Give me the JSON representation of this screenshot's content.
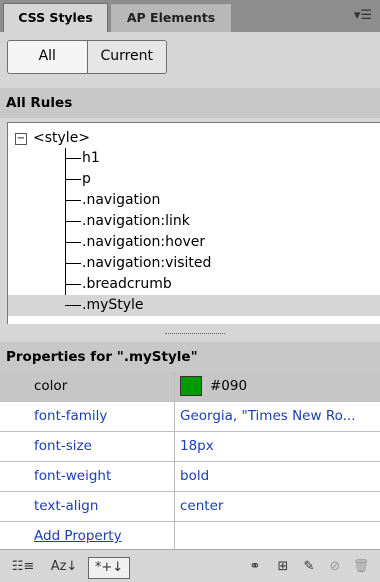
{
  "tabs": [
    {
      "label": "CSS Styles",
      "active": true
    },
    {
      "label": "AP Elements",
      "active": false
    }
  ],
  "mode": {
    "all": "All",
    "current": "Current",
    "selected": "All"
  },
  "all_rules": {
    "heading": "All Rules",
    "root": "<style>",
    "root_expander": "−",
    "items": [
      "h1",
      "p",
      ".navigation",
      ".navigation:link",
      ".navigation:hover",
      ".navigation:visited",
      ".breadcrumb",
      ".myStyle"
    ],
    "selected": ".myStyle"
  },
  "properties": {
    "heading": "Properties for \".myStyle\"",
    "rows": [
      {
        "name": "color",
        "value": "#090",
        "swatch": "#009900"
      },
      {
        "name": "font-family",
        "value": "Georgia, \"Times New Ro..."
      },
      {
        "name": "font-size",
        "value": "18px"
      },
      {
        "name": "font-weight",
        "value": "bold"
      },
      {
        "name": "text-align",
        "value": "center"
      }
    ],
    "add_label": "Add Property"
  },
  "toolbar": {
    "category_view": "☷≡",
    "alpha_view": "Az↓",
    "set_props_view": "*+↓",
    "icons": [
      "attach-style-sheet-icon",
      "new-css-rule-icon",
      "edit-rule-icon",
      "disable-property-icon",
      "delete-icon"
    ]
  },
  "colors": {
    "swatch": "#009900",
    "link": "#1a3fb3",
    "panel_bg": "#d6d6d6"
  }
}
